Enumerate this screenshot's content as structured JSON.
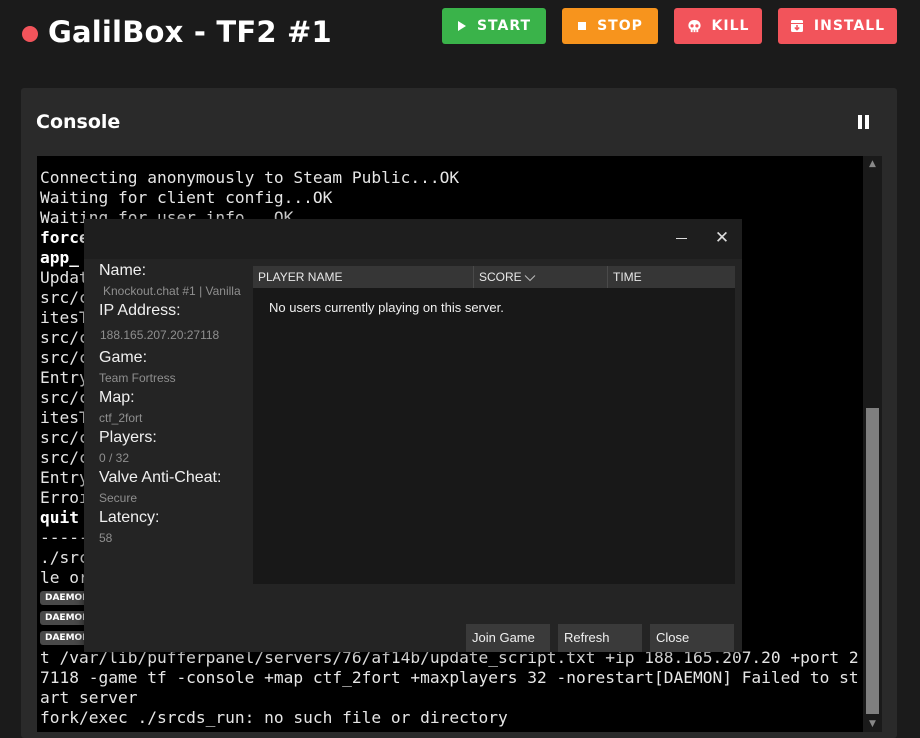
{
  "header": {
    "title": "GalilBox - TF2 #1",
    "status_color": "#f2545b",
    "buttons": [
      {
        "label": "START",
        "icon": "play-icon",
        "color": "#3ab34a"
      },
      {
        "label": "STOP",
        "icon": "stop-icon",
        "color": "#f7941d"
      },
      {
        "label": "KILL",
        "icon": "skull-icon",
        "color": "#f2545b"
      },
      {
        "label": "INSTALL",
        "icon": "install-box-icon",
        "color": "#f2545b"
      }
    ]
  },
  "console": {
    "title": "Console",
    "pause_icon": "pause-icon",
    "lines": [
      {
        "text": "Connecting anonymously to Steam Public...OK",
        "bold": false
      },
      {
        "text": "Waiting for client config...OK",
        "bold": false
      },
      {
        "text": "Waiting for user info...OK",
        "bold": false
      },
      {
        "text": "force",
        "bold": true
      },
      {
        "text": "app_",
        "bold": true
      },
      {
        "text": "Updat                                              9703)",
        "bold": false
      },
      {
        "text": "src/c                                              Info->nNumWr",
        "bold": false
      },
      {
        "text": "itesT",
        "bold": false
      },
      {
        "text": "src/c",
        "bold": false
      },
      {
        "text": "src/c                                              Written <= p",
        "bold": false
      },
      {
        "text": "Entry",
        "bold": false
      },
      {
        "text": "src/c                                              Info->nNumWr",
        "bold": false
      },
      {
        "text": "itesT",
        "bold": false
      },
      {
        "text": "src/c",
        "bold": false
      },
      {
        "text": "src/c                                              Written <= p",
        "bold": false
      },
      {
        "text": "Entry",
        "bold": false
      },
      {
        "text": "Erroı",
        "bold": false
      },
      {
        "text": "quit",
        "bold": true
      },
      {
        "text": "-----",
        "bold": false
      },
      {
        "text": "./src                                            : No such fi",
        "bold": false
      },
      {
        "text": "le or",
        "bold": false
      },
      {
        "text": "",
        "bold": false
      },
      {
        "text": "",
        "bold": false
      },
      {
        "text": "        eamcmd_scrip",
        "bold": false
      },
      {
        "text": "t /var/lib/pufferpanel/servers/76/af14b/update_script.txt +ip 188.165.207.20 +port 2",
        "bold": false
      },
      {
        "text": "7118 -game tf -console +map ctf_2fort +maxplayers 32 -norestart[DAEMON] Failed to st",
        "bold": false
      },
      {
        "text": "art server",
        "bold": false
      },
      {
        "text": "fork/exec ./srcds_run: no such file or directory",
        "bold": false
      }
    ],
    "daemon_tags": [
      "DAEMON",
      "DAEMON",
      "DAEMON"
    ]
  },
  "dialog": {
    "info": [
      {
        "label": "Name:",
        "value": "Knockout.chat #1 | Vanilla"
      },
      {
        "label": "IP Address:",
        "value": "188.165.207.20:27118"
      },
      {
        "label": "Game:",
        "value": "Team Fortress"
      },
      {
        "label": "Map:",
        "value": "ctf_2fort"
      },
      {
        "label": "Players:",
        "value": "0 / 32"
      },
      {
        "label": "Valve Anti-Cheat:",
        "value": "Secure"
      },
      {
        "label": "Latency:",
        "value": "58"
      }
    ],
    "table": {
      "columns": [
        "PLAYER NAME",
        "SCORE",
        "TIME"
      ],
      "empty_message": "No users currently playing on this server."
    },
    "buttons": {
      "join": "Join Game",
      "refresh": "Refresh",
      "close": "Close"
    }
  }
}
